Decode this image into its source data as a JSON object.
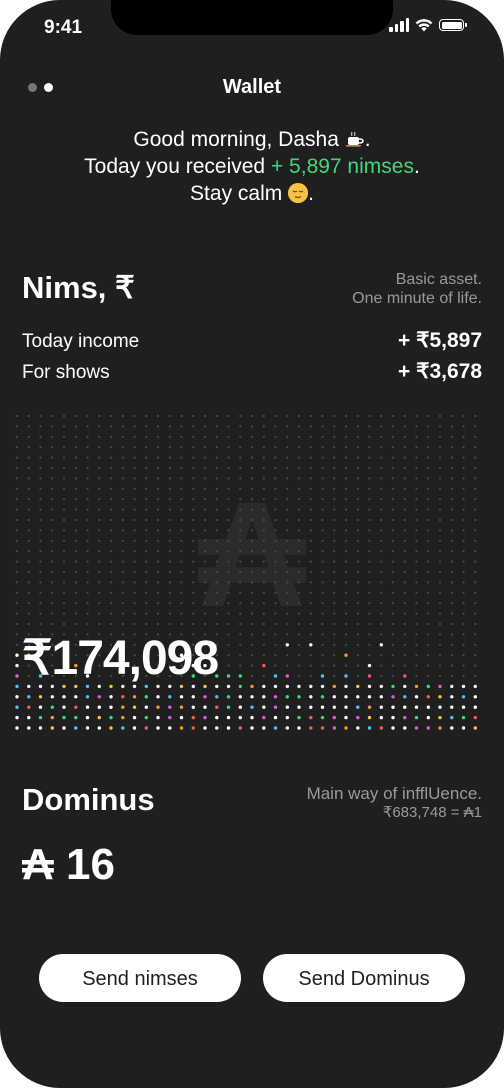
{
  "status_bar": {
    "time": "9:41"
  },
  "header": {
    "title": "Wallet",
    "page_dots": [
      {
        "active": false
      },
      {
        "active": true
      }
    ]
  },
  "greeting": {
    "line1": "Good morning, Dasha",
    "line1_end": ".",
    "line2_prefix": "Today you received ",
    "line2_highlight": "+ 5,897 nimses",
    "line2_end": ".",
    "line3": "Stay calm",
    "line3_end": ".",
    "highlight_color": "#3fd97a",
    "emoji1": "coffee-cup-icon",
    "emoji2": "relieved-face-icon"
  },
  "nims": {
    "title": "Nims, ₹",
    "note_line1": "Basic asset.",
    "note_line2": "One minute of life.",
    "rows": [
      {
        "label": "Today income",
        "value": "+ ₹5,897"
      },
      {
        "label": "For shows",
        "value": "+ ₹3,678"
      }
    ],
    "balance": "₹174,098",
    "watermark": "₳"
  },
  "dominus": {
    "title": "Dominus",
    "note_line1": "Main way of infflUence.",
    "note_line2": "₹683,748 = ₳1",
    "value": "₳ 16"
  },
  "actions": {
    "send_nimses": "Send nimses",
    "send_dominus": "Send Dominus"
  },
  "colors": {
    "background": "#1f1f20",
    "accent_green": "#3fd97a",
    "muted_text": "#9a9a9c",
    "dot_palette": [
      "#ffffff",
      "#f55b5b",
      "#f6c343",
      "#3fd97a",
      "#4fc3f7",
      "#e05bd8",
      "#f39c2b"
    ]
  }
}
